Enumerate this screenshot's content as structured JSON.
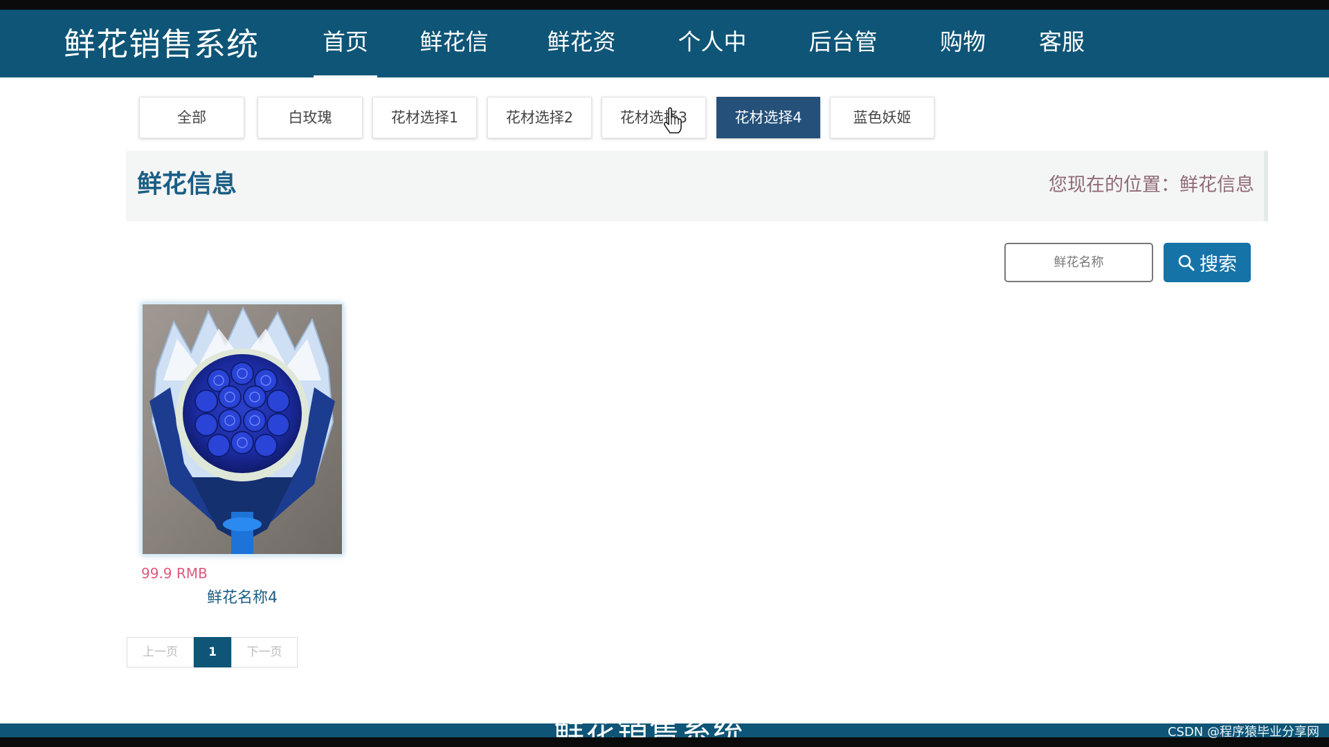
{
  "header": {
    "brand": "鲜花销售系统",
    "nav": [
      {
        "label": "首页",
        "active": true
      },
      {
        "label": "鲜花信息",
        "active": false
      },
      {
        "label": "鲜花资讯",
        "active": false
      },
      {
        "label": "个人中心",
        "active": false
      },
      {
        "label": "后台管理",
        "active": false
      },
      {
        "label": "购物车",
        "active": false
      },
      {
        "label": "客服",
        "active": false
      }
    ]
  },
  "categories": [
    {
      "label": "全部",
      "active": false
    },
    {
      "label": "白玫瑰",
      "active": false
    },
    {
      "label": "花材选择1",
      "active": false
    },
    {
      "label": "花材选择2",
      "active": false
    },
    {
      "label": "花材选择3",
      "active": false
    },
    {
      "label": "花材选择4",
      "active": true
    },
    {
      "label": "蓝色妖姬",
      "active": false
    }
  ],
  "title_bar": {
    "title": "鲜花信息",
    "location_label": "您现在的位置：",
    "location_value": "鲜花信息"
  },
  "search": {
    "placeholder": "鲜花名称",
    "button_label": "搜索",
    "button_icon": "search-icon"
  },
  "products": [
    {
      "price": "99.9 RMB",
      "name": "鲜花名称4",
      "image": "blue-rose-bouquet"
    }
  ],
  "pagination": {
    "prev": "上一页",
    "current": "1",
    "next": "下一页"
  },
  "footer": {
    "partial_text": "鲜花销售系统"
  },
  "watermark": "CSDN @程序猿毕业分享网",
  "colors": {
    "header_bg": "#0e5577",
    "active_category": "#24507a",
    "search_button": "#1573a8",
    "price": "#e0587c",
    "title": "#1b5e85",
    "location": "#906b76"
  }
}
